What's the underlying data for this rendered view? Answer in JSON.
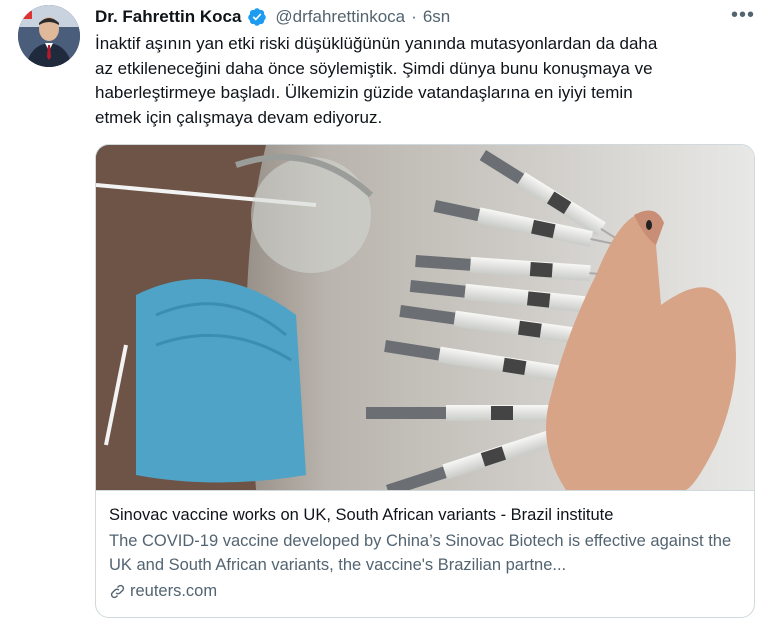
{
  "author": {
    "name": "Dr. Fahrettin Koca",
    "handle": "@drfahrettinkoca",
    "separator": "·",
    "time": "6sn"
  },
  "tweet": {
    "text": "İnaktif aşının yan etki riski düşüklüğünün yanında mutasyonlardan da daha\naz etkileneceğini daha önce söylemiştik. Şimdi dünya bunu konuşmaya ve\nhaberleştirmeye başladı. Ülkemizin güzide vatandaşlarına en iyiyi temin\netmek için çalışmaya devam ediyoruz."
  },
  "menu": {
    "more_label": "•••"
  },
  "card": {
    "title": "Sinovac vaccine works on UK, South African variants - Brazil institute",
    "description": "The COVID-19 vaccine developed by China’s Sinovac Biotech is effective against the UK and South African variants, the vaccine's Brazilian partne...",
    "domain": "reuters.com"
  },
  "icons": {
    "verified": "verified-badge-icon",
    "more": "more-options-icon",
    "link": "link-icon"
  },
  "colors": {
    "verified_blue": "#1d9bf0",
    "secondary_text": "#536471",
    "border": "#cfd9de"
  }
}
